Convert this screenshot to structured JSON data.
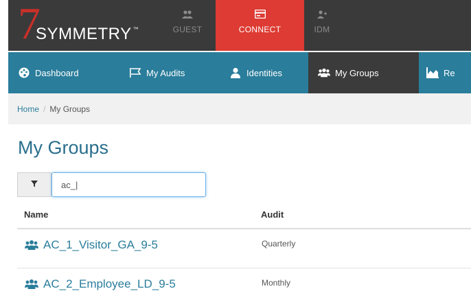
{
  "brand": {
    "seven": "7",
    "name": "SYMMETRY",
    "tm": "™"
  },
  "modules": [
    {
      "label": "GUEST",
      "icon": "users-icon"
    },
    {
      "label": "CONNECT",
      "icon": "card-icon",
      "active": true
    },
    {
      "label": "IDM",
      "icon": "user-plus-icon"
    }
  ],
  "nav": {
    "items": [
      {
        "label": "Dashboard",
        "icon": "palette-icon"
      },
      {
        "label": "My Audits",
        "icon": "flag-icon"
      },
      {
        "label": "Identities",
        "icon": "user-icon"
      },
      {
        "label": "My Groups",
        "icon": "group-icon",
        "active": true
      },
      {
        "label": "Re",
        "icon": "chart-icon"
      }
    ]
  },
  "breadcrumb": {
    "home": "Home",
    "separator": "/",
    "current": "My Groups"
  },
  "page": {
    "title": "My Groups"
  },
  "filter": {
    "value": "ac_|",
    "icon": "filter-icon"
  },
  "table": {
    "columns": [
      "Name",
      "Audit"
    ],
    "rows": [
      {
        "name": "AC_1_Visitor_GA_9-5",
        "audit": "Quarterly"
      },
      {
        "name": "AC_2_Employee_LD_9-5",
        "audit": "Monthly"
      }
    ]
  },
  "colors": {
    "topbar": "#3a3a3a",
    "brand_red": "#dd3b33",
    "nav_teal": "#2a7d9b",
    "nav_active": "#3b3b3b",
    "link": "#2a7d9b"
  }
}
